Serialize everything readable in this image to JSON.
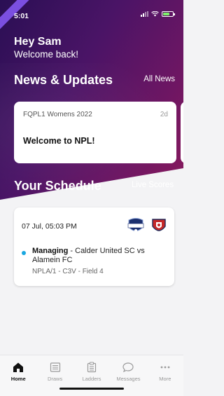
{
  "status_bar": {
    "time": "5:01"
  },
  "greeting": {
    "title": "Hey Sam",
    "subtitle": "Welcome back!"
  },
  "news": {
    "title": "News & Updates",
    "link_label": "All News",
    "card": {
      "league": "FQPL1 Womens 2022",
      "age": "2d",
      "headline": "Welcome to NPL!"
    }
  },
  "schedule": {
    "title": "Your Schedule",
    "link_label": "Live Scores",
    "match": {
      "date": "07 Jul, 05:03 PM",
      "role": "Managing",
      "teams": " - Calder United SC vs Alamein FC",
      "meta": "NPLA/1 - C3V - Field 4",
      "status_color": "#19a7e0"
    }
  },
  "tabs": [
    {
      "label": "Home",
      "icon": "home-icon",
      "active": true
    },
    {
      "label": "Draws",
      "icon": "draws-icon",
      "active": false
    },
    {
      "label": "Ladders",
      "icon": "ladders-icon",
      "active": false
    },
    {
      "label": "Messages",
      "icon": "messages-icon",
      "active": false
    },
    {
      "label": "More",
      "icon": "more-icon",
      "active": false
    }
  ]
}
